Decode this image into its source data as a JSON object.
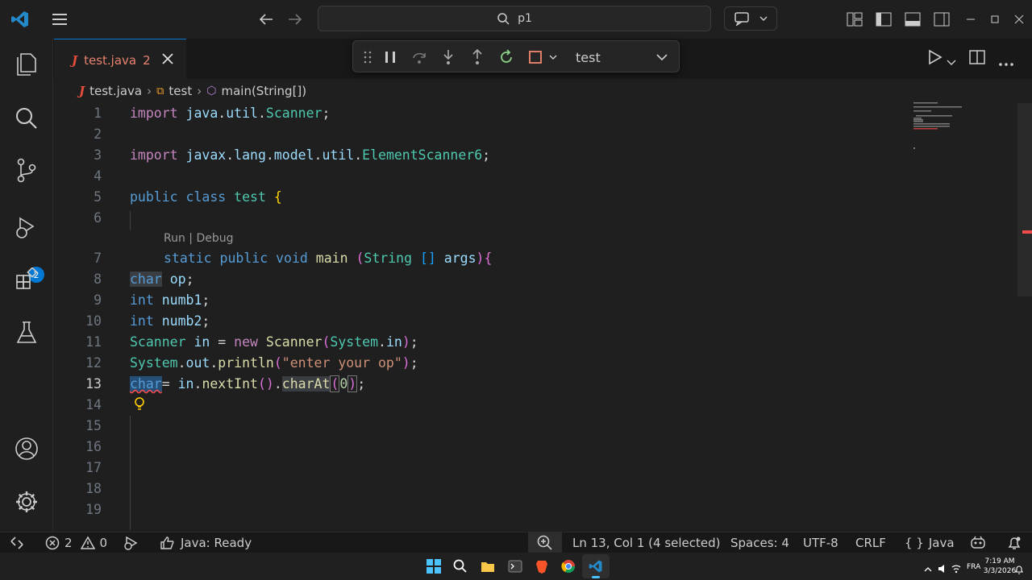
{
  "search": {
    "text": "p1"
  },
  "tab": {
    "file_name": "test.java",
    "problem_count": "2"
  },
  "debug": {
    "config": "test"
  },
  "breadcrumb": {
    "file": "test.java",
    "class": "test",
    "method": "main(String[])"
  },
  "editor": {
    "codelens": "Run | Debug",
    "line_numbers": [
      "1",
      "2",
      "3",
      "4",
      "5",
      "6",
      "7",
      "8",
      "9",
      "10",
      "11",
      "12",
      "13",
      "14",
      "15",
      "16",
      "17",
      "18",
      "19"
    ]
  },
  "activity": {
    "debug_badge": "2"
  },
  "status": {
    "errors": "2",
    "warnings": "0",
    "java_status": "Java: Ready",
    "position": "Ln 13, Col 1 (4 selected)",
    "spaces": "Spaces: 4",
    "encoding": "UTF-8",
    "eol": "CRLF",
    "language": "Java"
  },
  "taskbar": {
    "lang": "FRA",
    "time": "7:19 AM",
    "date": "3/3/2026"
  },
  "colors": {
    "accent": "#0078d4",
    "keyword": "#569cd6",
    "type": "#4ec9b0",
    "string": "#ce9178",
    "function": "#dcdcaa",
    "variable": "#9cdcfe"
  }
}
